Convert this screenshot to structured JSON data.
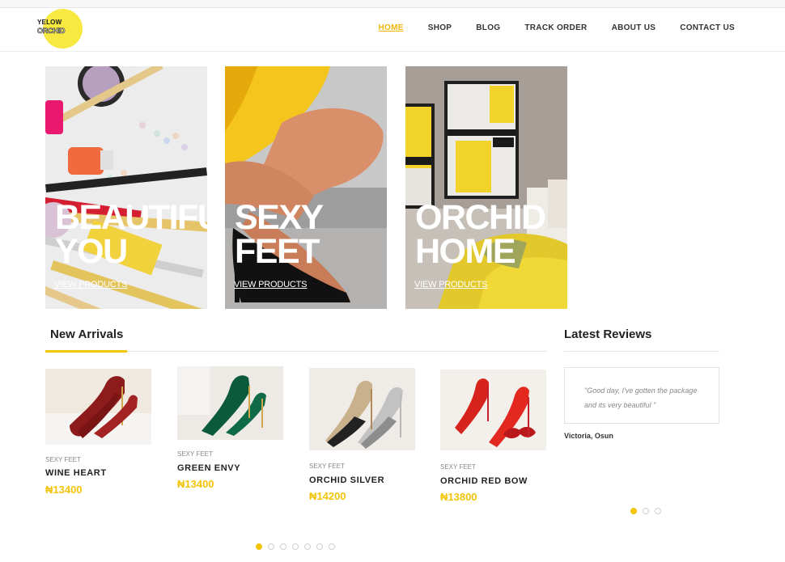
{
  "brand": {
    "line1": "YELOW",
    "line2": "ORCHID",
    "accent_color": "#f2c40a"
  },
  "nav": {
    "items": [
      {
        "label": "HOME",
        "active": true
      },
      {
        "label": "SHOP"
      },
      {
        "label": "BLOG"
      },
      {
        "label": "TRACK ORDER"
      },
      {
        "label": "ABOUT US"
      },
      {
        "label": "CONTACT US"
      }
    ]
  },
  "banners": [
    {
      "title": "BEAUTIFUL YOU",
      "link": "VIEW PRODUCTS"
    },
    {
      "title": "SEXY FEET",
      "link": "VIEW PRODUCTS"
    },
    {
      "title": "ORCHID HOME",
      "link": "VIEW PRODUCTS"
    }
  ],
  "new_arrivals": {
    "heading": "New Arrivals",
    "products": [
      {
        "category": "SEXY FEET",
        "name": "WINE HEART",
        "price": "₦13400",
        "color": "#8e1b1b"
      },
      {
        "category": "SEXY FEET",
        "name": "GREEN ENVY",
        "price": "₦13400",
        "color": "#0c5a3e"
      },
      {
        "category": "SEXY FEET",
        "name": "ORCHID SILVER",
        "price": "₦14200",
        "color": "#b9b9b9"
      },
      {
        "category": "SEXY FEET",
        "name": "ORCHID RED BOW",
        "price": "₦13800",
        "color": "#d6231c"
      }
    ],
    "pager": {
      "total": 7,
      "active": 1
    }
  },
  "reviews": {
    "heading": "Latest Reviews",
    "items": [
      {
        "text": "\"Good day, I've gotten the package and its very beautiful \"",
        "author": "Victoria, Osun"
      }
    ],
    "pager": {
      "total": 3,
      "active": 1
    }
  }
}
